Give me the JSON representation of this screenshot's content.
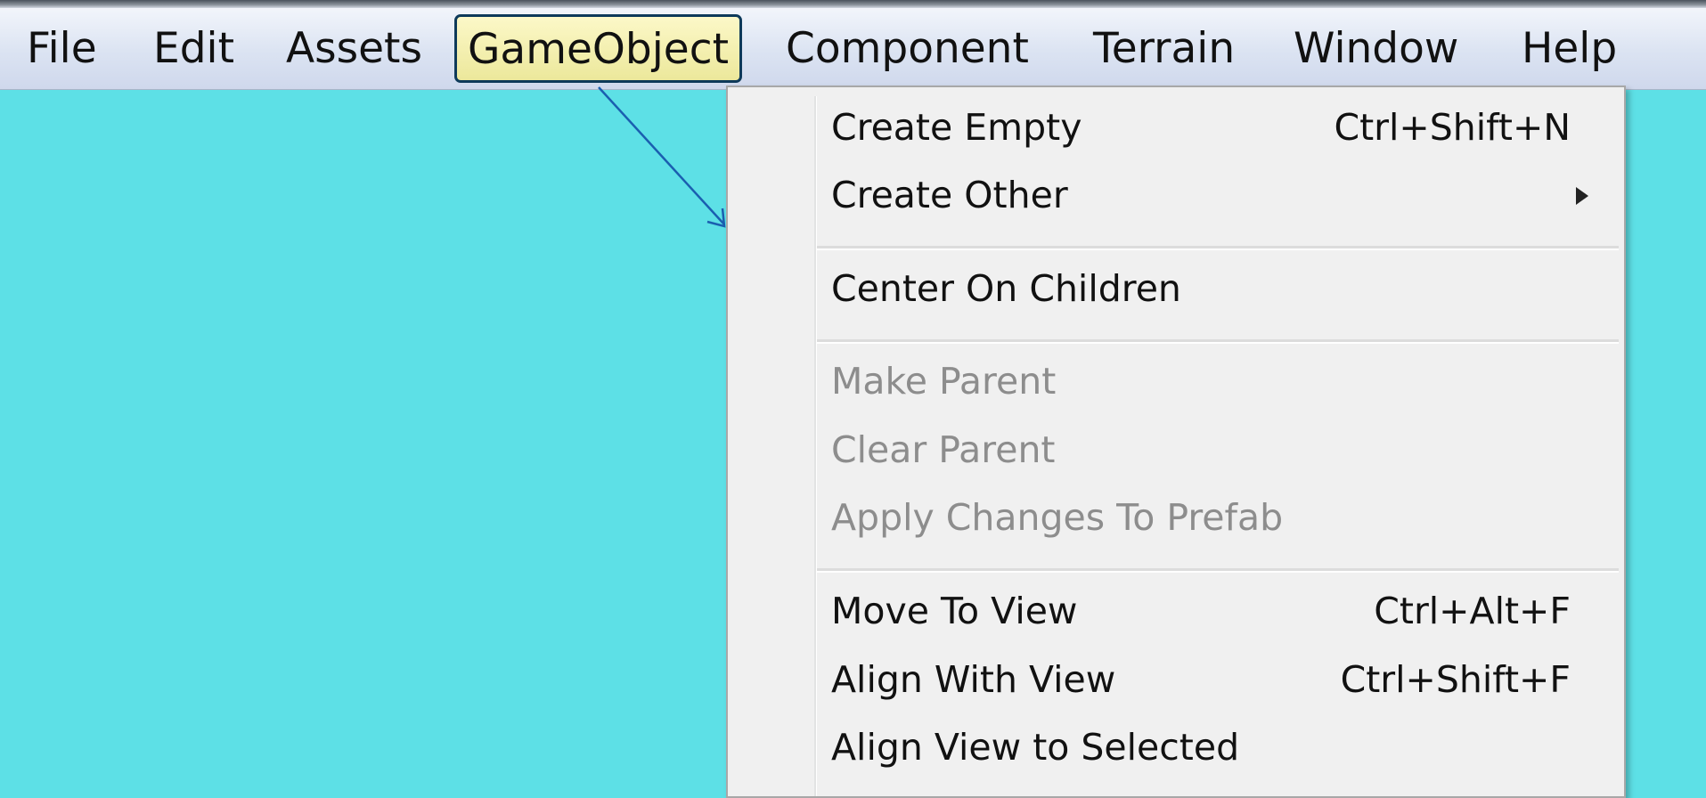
{
  "menubar": {
    "items": [
      {
        "label": "File"
      },
      {
        "label": "Edit"
      },
      {
        "label": "Assets"
      },
      {
        "label": "GameObject"
      },
      {
        "label": "Component"
      },
      {
        "label": "Terrain"
      },
      {
        "label": "Window"
      },
      {
        "label": "Help"
      }
    ],
    "active_index": 3
  },
  "gameobject_menu": {
    "items": [
      {
        "label": "Create Empty",
        "shortcut": "Ctrl+Shift+N",
        "enabled": true
      },
      {
        "label": "Create Other",
        "shortcut": "",
        "enabled": true,
        "submenu": true
      },
      {
        "label": "Center On Children",
        "shortcut": "",
        "enabled": true
      },
      {
        "label": "Make Parent",
        "shortcut": "",
        "enabled": false
      },
      {
        "label": "Clear Parent",
        "shortcut": "",
        "enabled": false
      },
      {
        "label": "Apply Changes To Prefab",
        "shortcut": "",
        "enabled": false
      },
      {
        "label": "Move To View",
        "shortcut": "Ctrl+Alt+F",
        "enabled": true
      },
      {
        "label": "Align With View",
        "shortcut": "Ctrl+Shift+F",
        "enabled": true
      },
      {
        "label": "Align View to Selected",
        "shortcut": "",
        "enabled": true
      }
    ]
  },
  "colors": {
    "background": "#5de0e6",
    "menu_highlight": "#f6f1b2",
    "highlight_border": "#0e3a5a",
    "pointer_line": "#1a5fb0",
    "disabled_text": "#8d8d8d"
  }
}
